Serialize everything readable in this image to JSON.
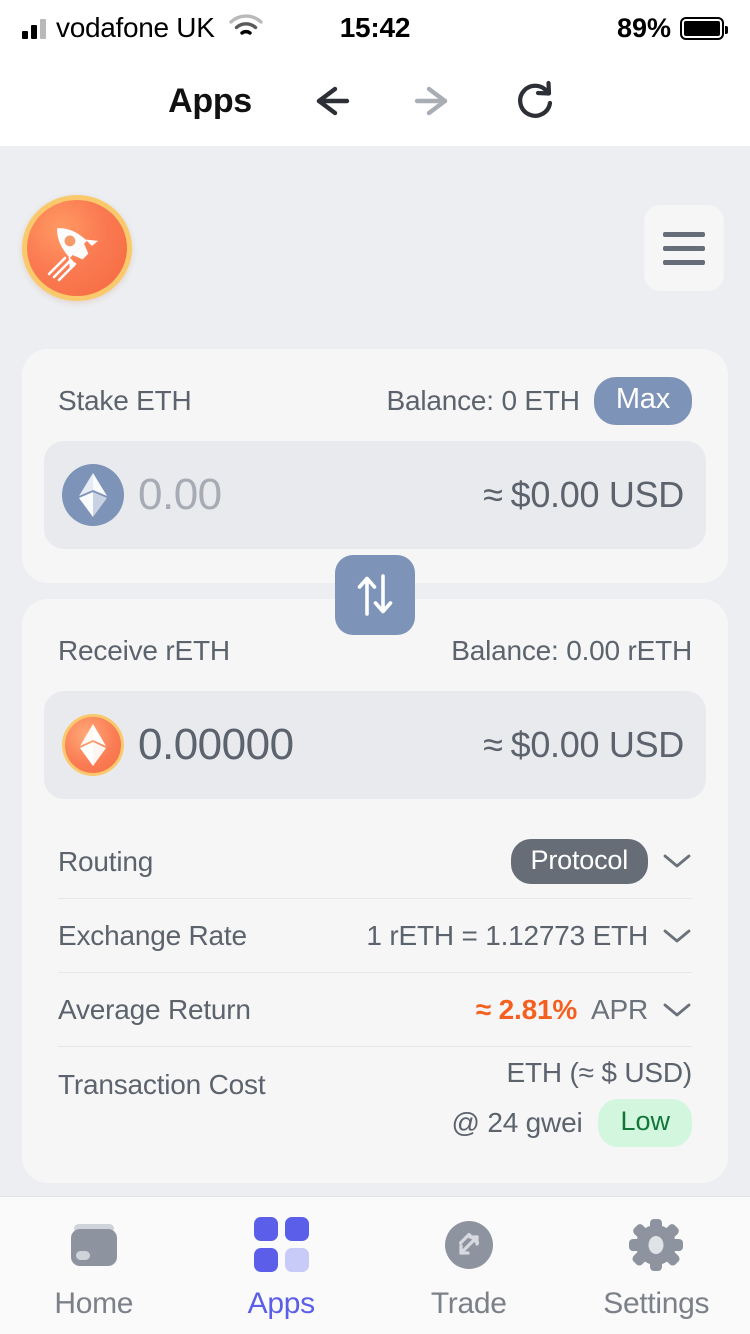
{
  "status_bar": {
    "carrier": "vodafone UK",
    "wifi_icon": "wifi-icon",
    "time": "15:42",
    "battery_percent": "89%",
    "battery_icon": "battery-icon"
  },
  "nav_bar": {
    "title": "Apps",
    "back_icon": "arrow-left-icon",
    "forward_icon": "arrow-right-icon",
    "reload_icon": "reload-icon"
  },
  "app_header": {
    "logo_icon": "rocket-icon",
    "logo_alt": "Rocket Pool",
    "menu_icon": "hamburger-menu-icon"
  },
  "stake_card": {
    "label": "Stake ETH",
    "balance": "Balance: 0 ETH",
    "max_label": "Max",
    "token_icon": "ethereum-icon",
    "amount": "0.00",
    "amount_placeholder": "0.00",
    "approx_symbol": "≈",
    "usd_value": "$0.00 USD"
  },
  "swap": {
    "icon": "swap-vertical-icon"
  },
  "receive_card": {
    "label": "Receive rETH",
    "balance": "Balance: 0.00 rETH",
    "token_icon": "rocketpool-eth-icon",
    "amount": "0.00000",
    "approx_symbol": "≈",
    "usd_value": "$0.00 USD"
  },
  "details": [
    {
      "key": "Routing",
      "badge": "Protocol",
      "value": "",
      "chevron": "chevron-down-icon",
      "name": "routing"
    },
    {
      "key": "Exchange Rate",
      "badge": "",
      "value": "1 rETH = 1.12773 ETH",
      "chevron": "chevron-down-icon",
      "name": "exchange-rate"
    },
    {
      "key": "Average Return",
      "badge": "",
      "value_highlight": "≈ 2.81%",
      "value_suffix": "APR",
      "chevron": "chevron-down-icon",
      "name": "average-return"
    }
  ],
  "transaction_cost": {
    "key": "Transaction Cost",
    "value": "ETH (≈ $ USD)",
    "gwei": "@ 24 gwei",
    "speed_badge": "Low"
  },
  "tabs": [
    {
      "label": "Home",
      "icon": "wallet-icon",
      "active": false
    },
    {
      "label": "Apps",
      "icon": "apps-grid-icon",
      "active": true
    },
    {
      "label": "Trade",
      "icon": "expand-arrows-icon",
      "active": false
    },
    {
      "label": "Settings",
      "icon": "gear-icon",
      "active": false
    }
  ],
  "colors": {
    "page_bg": "#eceef1",
    "card_bg": "#f6f6f7",
    "input_bg": "#e8eaee",
    "accent_blue": "#7d93b8",
    "accent_indigo": "#5b5ee8",
    "accent_orange": "#f4601f",
    "badge_dark": "#676d77",
    "badge_green_bg": "#d3f7de",
    "badge_green_text": "#12763a",
    "text_muted": "#5c636d"
  }
}
